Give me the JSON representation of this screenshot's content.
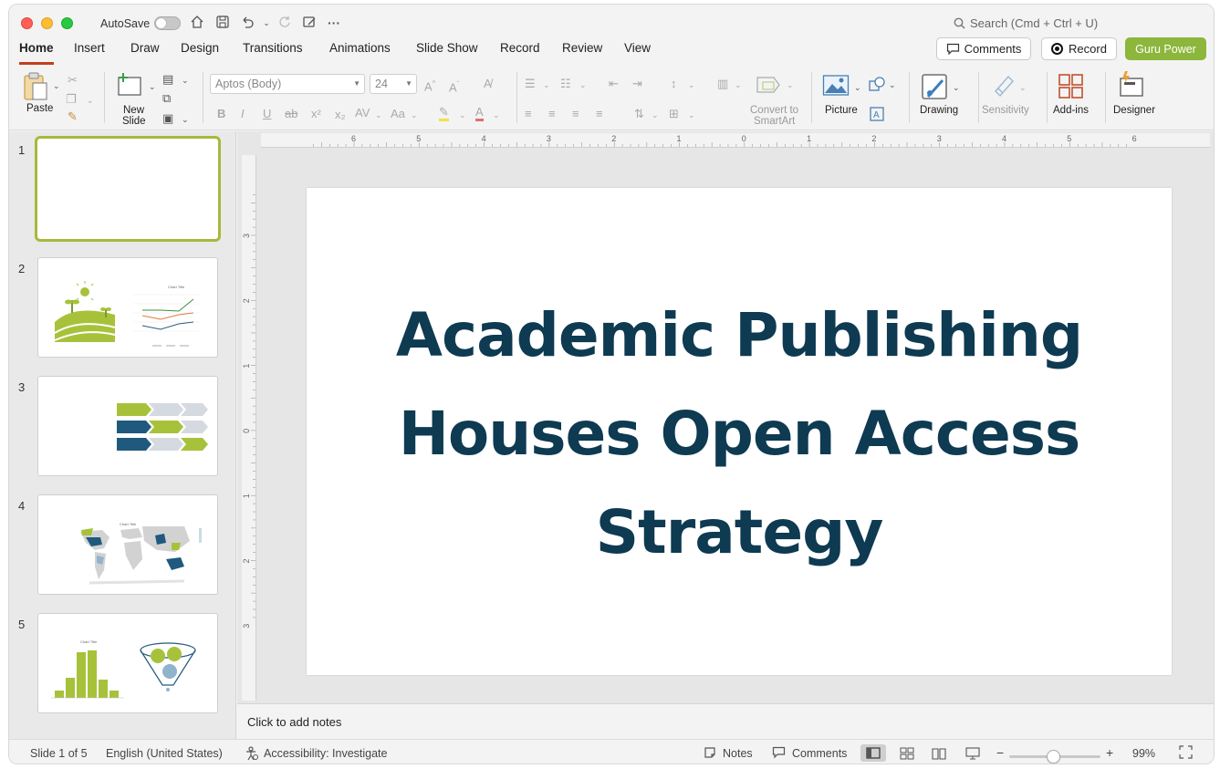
{
  "titlebar": {
    "autosave_label": "AutoSave",
    "search_placeholder": "Search (Cmd + Ctrl + U)"
  },
  "tabs": [
    "Home",
    "Insert",
    "Draw",
    "Design",
    "Transitions",
    "Animations",
    "Slide Show",
    "Record",
    "Review",
    "View"
  ],
  "header_buttons": {
    "comments": "Comments",
    "record": "Record",
    "guru": "Guru Power"
  },
  "ribbon": {
    "paste": "Paste",
    "new_slide_1": "New",
    "new_slide_2": "Slide",
    "font_name": "Aptos (Body)",
    "font_size": "24",
    "convert_1": "Convert to",
    "convert_2": "SmartArt",
    "picture": "Picture",
    "drawing": "Drawing",
    "sensitivity": "Sensitivity",
    "addins": "Add-ins",
    "designer": "Designer"
  },
  "slides": {
    "numbers": [
      "1",
      "2",
      "3",
      "4",
      "5"
    ],
    "thumb2_chart_title": "Chart Title",
    "thumb4_chart_title": "Chart Title",
    "thumb5_chart_title": "Chart Title"
  },
  "slide": {
    "title_line1": "Academic Publishing",
    "title_line2": "Houses Open Access",
    "title_line3": "Strategy"
  },
  "ruler": {
    "h_ticks": [
      "6",
      "5",
      "4",
      "3",
      "2",
      "1",
      "0",
      "1",
      "2",
      "3",
      "4",
      "5",
      "6"
    ],
    "v_ticks": [
      "3",
      "2",
      "1",
      "0",
      "1",
      "2",
      "3"
    ]
  },
  "notes_placeholder": "Click to add notes",
  "status": {
    "slide_count": "Slide 1 of 5",
    "language": "English (United States)",
    "accessibility": "Accessibility: Investigate",
    "notes": "Notes",
    "comments": "Comments",
    "zoom": "99%"
  },
  "colors": {
    "accent_green": "#8cb63c",
    "title_navy": "#0e3a52",
    "active_tab_underline": "#c43e1c"
  }
}
